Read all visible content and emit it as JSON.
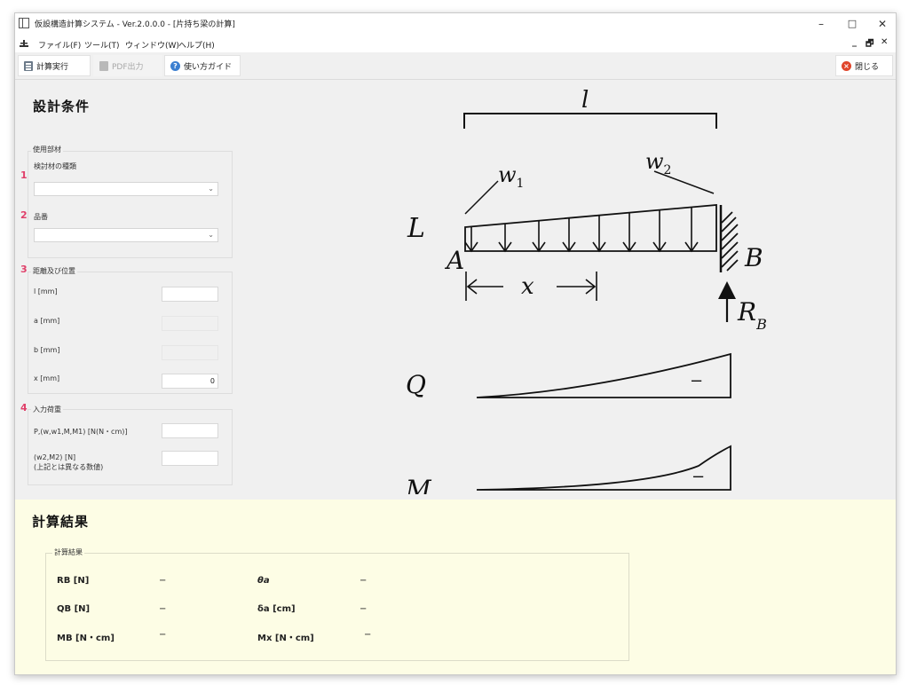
{
  "window": {
    "title": "仮設構造計算システム - Ver.2.0.0.0 - [片持ち梁の計算]",
    "minimize": "–",
    "maximize": "□",
    "close": "✕"
  },
  "menu": {
    "items": [
      "ファイル(F)",
      "ツール(T)",
      "ウィンドウ(W)",
      "ヘルプ(H)"
    ],
    "mdi_controls": [
      "_",
      "🗗",
      "✕"
    ]
  },
  "toolbar": {
    "run_label": "計算実行",
    "pdf_label": "PDF出力",
    "guide_label": "使い方ガイド",
    "close_label": "閉じる"
  },
  "conditions": {
    "title": "設計条件",
    "member_group": "使用部材",
    "badges": [
      "1",
      "2",
      "3",
      "4"
    ],
    "material_label": "検討材の種類",
    "material_value": "",
    "part_label": "品番",
    "part_value": "",
    "distance_group": "距離及び位置",
    "fields": [
      {
        "label": "l [mm]",
        "value": ""
      },
      {
        "label": "a [mm]",
        "value": ""
      },
      {
        "label": "b [mm]",
        "value": ""
      },
      {
        "label": "x [mm]",
        "value": "0"
      }
    ],
    "load_group": "入力荷重",
    "load_p_label": "P,(w,w1,M,M1) [N(N・cm)]",
    "load_p_value": "",
    "load_w2_label": "(w2,M2) [N]",
    "load_w2_note": "(上記とは異なる数値)",
    "load_w2_value": ""
  },
  "diagram": {
    "span": "l",
    "w1": "w",
    "w1_sub": "1",
    "w2": "w",
    "w2_sub": "2",
    "beam": "L",
    "support_a": "A",
    "support_b": "B",
    "x": "x",
    "reaction": "R",
    "reaction_sub": "B",
    "shear": "Q",
    "moment": "M",
    "shear_sign": "−",
    "moment_sign": "−"
  },
  "results": {
    "title": "計算結果",
    "group": "計算結果",
    "left": [
      {
        "label": "RB [N]",
        "value": "−"
      },
      {
        "label": "QB [N]",
        "value": "−"
      },
      {
        "label": "MB [N・cm]",
        "value": "−"
      }
    ],
    "right": [
      {
        "label": "θa",
        "value": "−"
      },
      {
        "label": "δa [cm]",
        "value": "−"
      },
      {
        "label": "Mx [N・cm]",
        "value": "−"
      }
    ]
  }
}
